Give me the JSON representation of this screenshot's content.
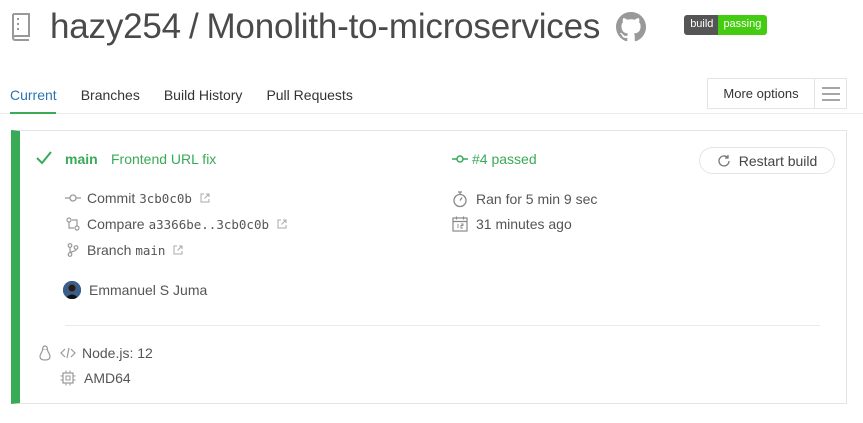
{
  "repo": {
    "owner": "hazy254",
    "separator": "/",
    "name": "Monolith-to-microservices",
    "badge_left": "build",
    "badge_right": "passing"
  },
  "tabs": [
    {
      "label": "Current",
      "active": true
    },
    {
      "label": "Branches",
      "active": false
    },
    {
      "label": "Build History",
      "active": false
    },
    {
      "label": "Pull Requests",
      "active": false
    }
  ],
  "more_options": {
    "label": "More options"
  },
  "build": {
    "branch": "main",
    "message": "Frontend URL fix",
    "number_status": "#4 passed",
    "restart_label": "Restart build",
    "commit_label": "Commit",
    "commit_sha": "3cb0c0b",
    "compare_label": "Compare",
    "compare_range": "a3366be..3cb0c0b",
    "branch_label": "Branch",
    "branch_value": "main",
    "author": "Emmanuel S Juma",
    "duration": "Ran for 5 min 9 sec",
    "finished": "31 minutes ago",
    "language": "Node.js: 12",
    "arch": "AMD64"
  },
  "colors": {
    "passed": "#39aa56",
    "link": "#2a75b1",
    "badge_dark": "#555555",
    "badge_green": "#44cc11"
  },
  "icons": [
    "repo-icon",
    "github-icon",
    "hamburger-icon",
    "check-icon",
    "commit-icon",
    "restart-icon",
    "compare-icon",
    "branch-icon",
    "external-link-icon",
    "stopwatch-icon",
    "calendar-icon",
    "linux-icon",
    "code-icon",
    "cpu-icon"
  ]
}
